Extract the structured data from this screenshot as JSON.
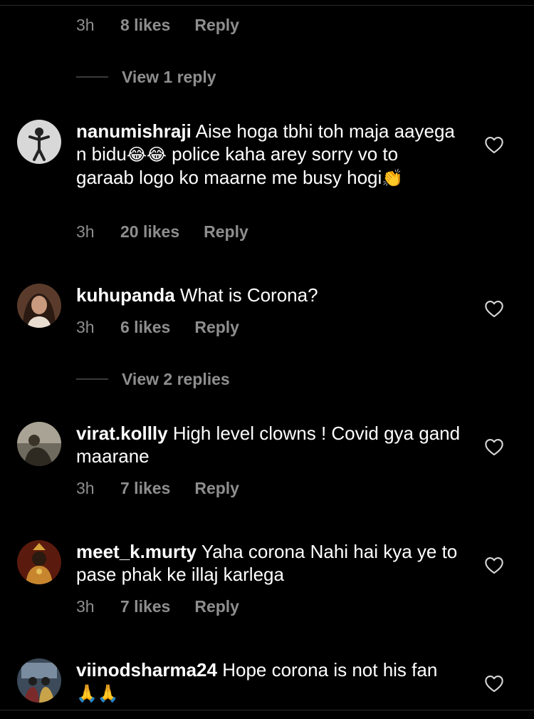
{
  "top_meta": {
    "time": "3h",
    "likes": "8 likes",
    "reply": "Reply"
  },
  "view_replies_1": "View 1 reply",
  "view_replies_2": "View 2 replies",
  "comments": [
    {
      "username": "nanumishraji",
      "text": "Aise hoga tbhi toh maja aayega n bidu",
      "text_emoji_1": "😂😂",
      "text_2": " police kaha arey sorry vo to garaab logo ko maarne me busy hogi",
      "text_emoji_2": "👏",
      "time": "3h",
      "likes": "20 likes",
      "reply": "Reply"
    },
    {
      "username": "kuhupanda",
      "text": "What is Corona?",
      "time": "3h",
      "likes": "6 likes",
      "reply": "Reply"
    },
    {
      "username": "virat.kollly",
      "text": "High level clowns ! Covid gya gand maarane",
      "time": "3h",
      "likes": "7 likes",
      "reply": "Reply"
    },
    {
      "username": "meet_k.murty",
      "text": "Yaha corona Nahi hai kya ye to pase phak ke illaj karlega",
      "time": "3h",
      "likes": "7 likes",
      "reply": "Reply"
    },
    {
      "username": "viinodsharma24",
      "text": "Hope corona is not his fan",
      "text_emoji_1": "🙏🙏"
    }
  ],
  "icons": {
    "like": "heart-outline-icon"
  },
  "colors": {
    "background": "#000000",
    "text": "#ffffff",
    "meta": "#8e8e8e"
  }
}
